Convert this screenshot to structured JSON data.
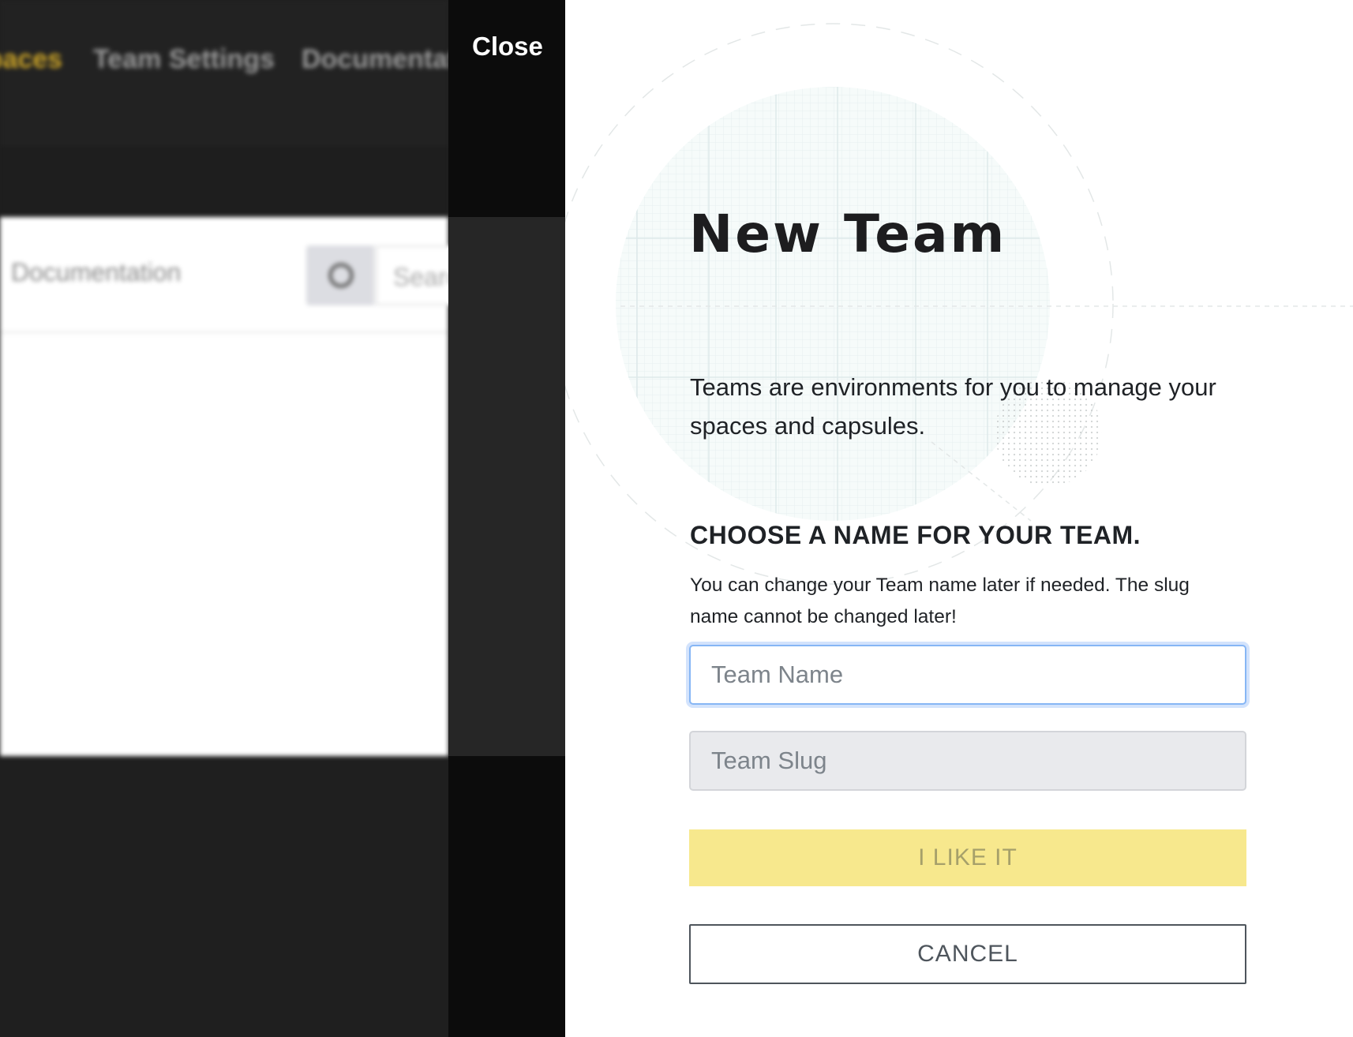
{
  "background_app": {
    "nav": {
      "spaces_label": "Spaces",
      "team_settings_label": "Team Settings",
      "documentation_label": "Documentation"
    },
    "panel": {
      "title": "Documentation",
      "search_placeholder": "Search"
    }
  },
  "overlay": {
    "close_label": "Close"
  },
  "modal": {
    "title": "New Team",
    "intro": "Teams are environments for you to manage your spaces and capsules.",
    "section_heading": "CHOOSE A NAME FOR YOUR TEAM.",
    "section_help": "You can change your Team name later if needed. The slug name cannot be changed later!",
    "team_name": {
      "value": "",
      "placeholder": "Team Name"
    },
    "team_slug": {
      "value": "",
      "placeholder": "Team Slug"
    },
    "submit_label": "I LIKE IT",
    "cancel_label": "CANCEL"
  },
  "colors": {
    "accent_yellow": "#f7e88d",
    "focus_blue": "#86b6f5",
    "text_dark": "#1f2226",
    "overlay_dark": "#0c0c0c"
  }
}
